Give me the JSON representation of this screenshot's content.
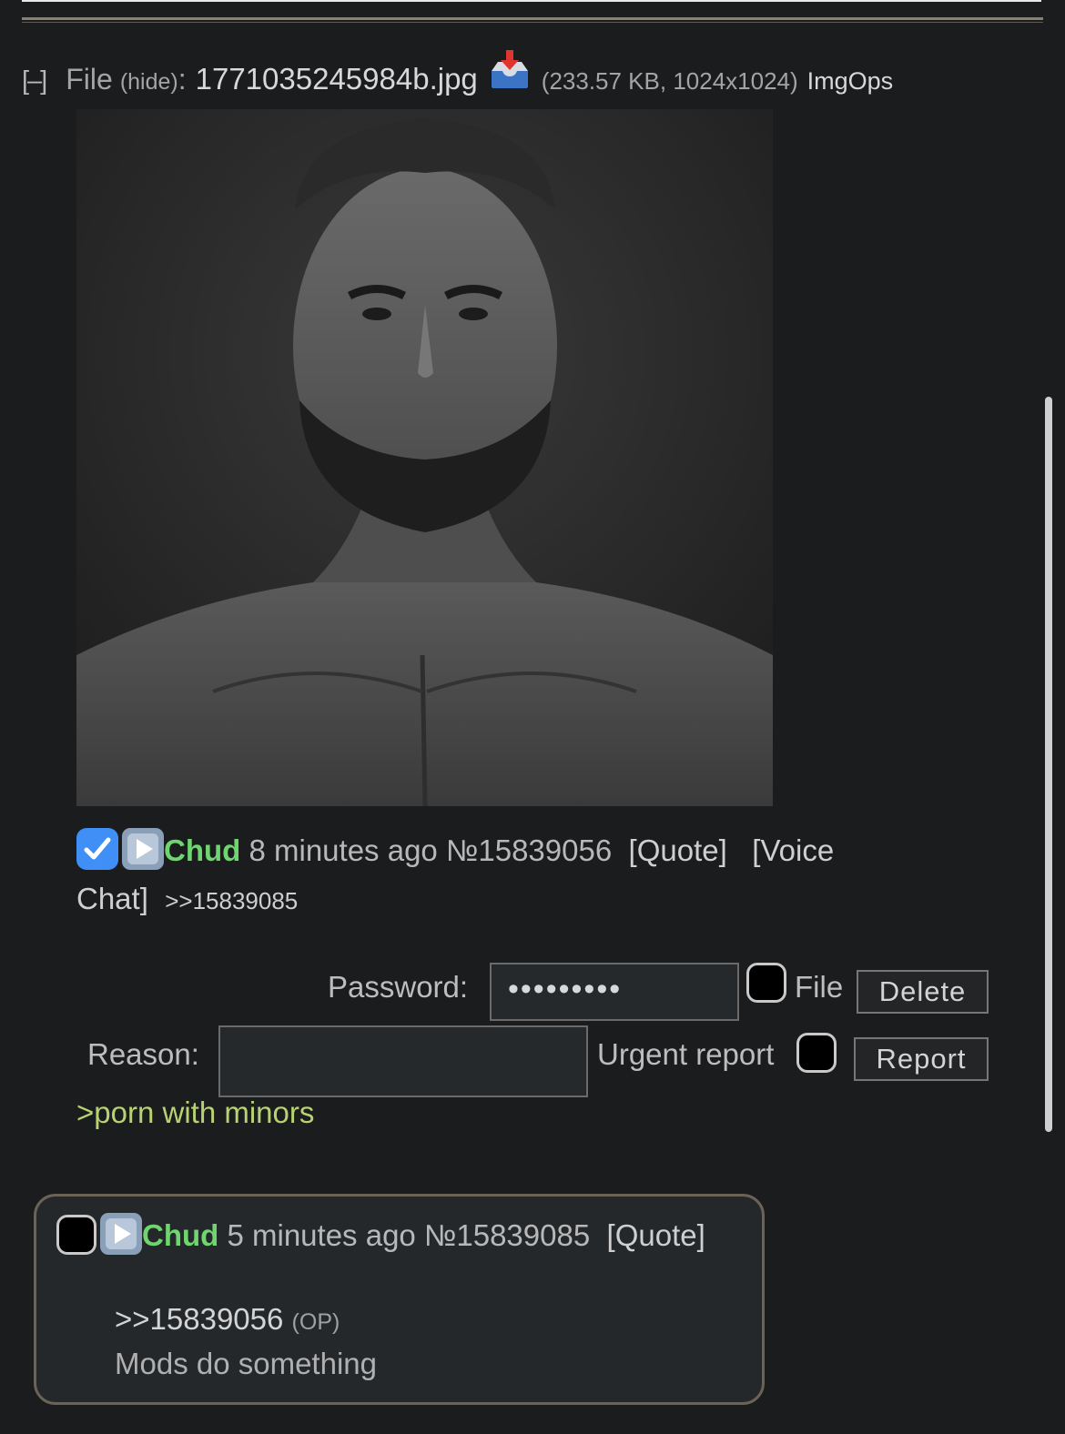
{
  "file": {
    "collapse_label": "[–]",
    "label": "File",
    "hide_label": "(hide)",
    "colon": ":",
    "filename": "1771035245984b.jpg",
    "meta": "(233.57 KB, 1024x1024)",
    "imgops": "ImgOps",
    "download_icon": "inbox-tray-icon"
  },
  "post": {
    "name": "Chud",
    "time": "8 minutes ago",
    "number": "№15839056",
    "quote": "[Quote]",
    "voice_chat_1": "[Voice",
    "voice_chat_2": "Chat]",
    "backlink": ">>15839085",
    "checkbox_icon": "checkmark-icon",
    "play_icon": "play-button-icon"
  },
  "delete_form": {
    "password_label": "Password:",
    "password_value": "•••••••••",
    "file_label": "File",
    "delete_button": "Delete"
  },
  "report_form": {
    "reason_label": "Reason:",
    "reason_value": "",
    "urgent_label": "Urgent report",
    "report_button": "Report"
  },
  "post_body": ">porn with minors",
  "reply": {
    "name": "Chud",
    "time": "5 minutes ago",
    "number": "№15839085",
    "quote": "[Quote]",
    "quote_link": ">>15839056",
    "op_tag": "(OP)",
    "text": "Mods do something"
  },
  "colors": {
    "background": "#1b1c1e",
    "name_green": "#6fd66f",
    "greentext": "#b8d272",
    "checkbox_blue": "#3f8ff7",
    "reply_border": "#6b6356"
  }
}
